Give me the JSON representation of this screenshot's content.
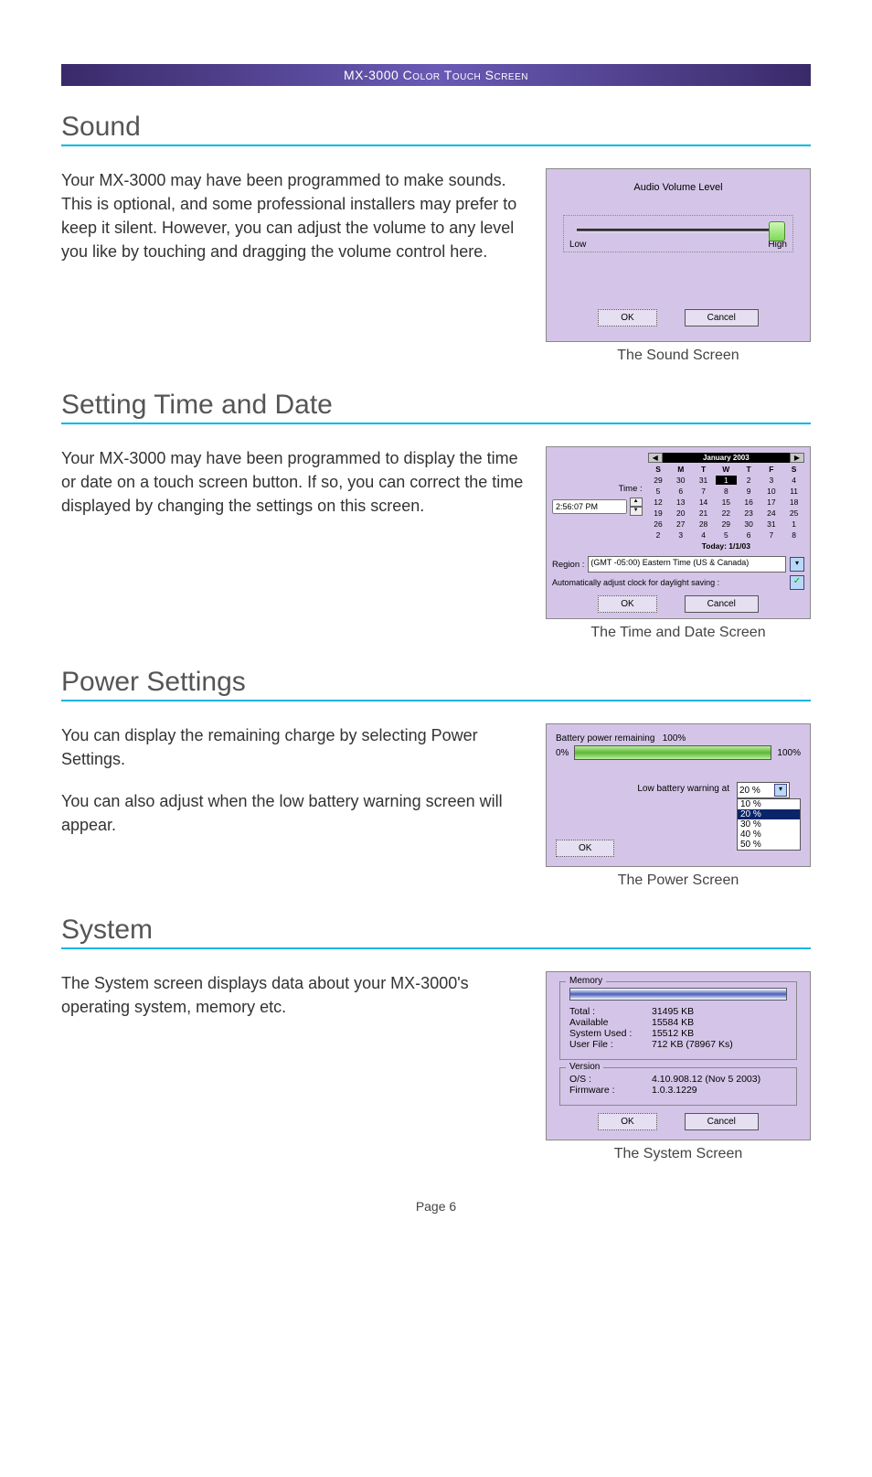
{
  "header": "MX-3000 Color Touch Screen",
  "page_label": "Page 6",
  "sections": {
    "sound": {
      "title": "Sound",
      "body": "Your MX-3000 may have been programmed to make sounds. This is optional, and some professional installers may prefer to keep it silent. However, you can adjust the volume to any level you like by touching and dragging the volume control here.",
      "caption": "The Sound Screen",
      "panel": {
        "title": "Audio Volume Level",
        "low": "Low",
        "high": "High",
        "ok": "OK",
        "cancel": "Cancel"
      }
    },
    "time": {
      "title": "Setting Time and Date",
      "body": "Your MX-3000 may have been programmed to display the time or date on a touch screen button. If so, you can correct the time displayed by changing the settings on this screen.",
      "caption": "The Time and Date Screen",
      "panel": {
        "time_label": "Time :",
        "time_value": "2:56:07 PM",
        "month": "January 2003",
        "dow": [
          "S",
          "M",
          "T",
          "W",
          "T",
          "F",
          "S"
        ],
        "weeks": [
          [
            "29",
            "30",
            "31",
            "1",
            "2",
            "3",
            "4"
          ],
          [
            "5",
            "6",
            "7",
            "8",
            "9",
            "10",
            "11"
          ],
          [
            "12",
            "13",
            "14",
            "15",
            "16",
            "17",
            "18"
          ],
          [
            "19",
            "20",
            "21",
            "22",
            "23",
            "24",
            "25"
          ],
          [
            "26",
            "27",
            "28",
            "29",
            "30",
            "31",
            "1"
          ],
          [
            "2",
            "3",
            "4",
            "5",
            "6",
            "7",
            "8"
          ]
        ],
        "today": "Today: 1/1/03",
        "region_label": "Region :",
        "region_value": "(GMT -05:00) Eastern Time (US & Canada)",
        "dst_label": "Automatically adjust clock for daylight saving :",
        "ok": "OK",
        "cancel": "Cancel"
      }
    },
    "power": {
      "title": "Power Settings",
      "body1": "You can display the remaining charge by selecting Power Settings.",
      "body2": "You can also adjust when the low battery warning screen will appear.",
      "caption": "The Power Screen",
      "panel": {
        "remaining_label": "Battery power remaining",
        "remaining_value": "100%",
        "left": "0%",
        "right": "100%",
        "low_label": "Low battery warning at",
        "selected": "20 %",
        "options": [
          "10 %",
          "20 %",
          "30 %",
          "40 %",
          "50 %"
        ],
        "ok": "OK"
      }
    },
    "system": {
      "title": "System",
      "body": "The System screen displays data about your MX-3000's operating system, memory etc.",
      "caption": "The System Screen",
      "panel": {
        "memory_legend": "Memory",
        "rows": {
          "total_k": "Total :",
          "total_v": "31495 KB",
          "avail_k": "Available",
          "avail_v": "15584 KB",
          "sys_k": "System Used :",
          "sys_v": "15512 KB",
          "user_k": "User File :",
          "user_v": "712 KB  (78967 Ks)"
        },
        "version_legend": "Version",
        "os_k": "O/S :",
        "os_v": "4.10.908.12 (Nov 5 2003)",
        "fw_k": "Firmware :",
        "fw_v": "1.0.3.1229",
        "ok": "OK",
        "cancel": "Cancel"
      }
    }
  }
}
